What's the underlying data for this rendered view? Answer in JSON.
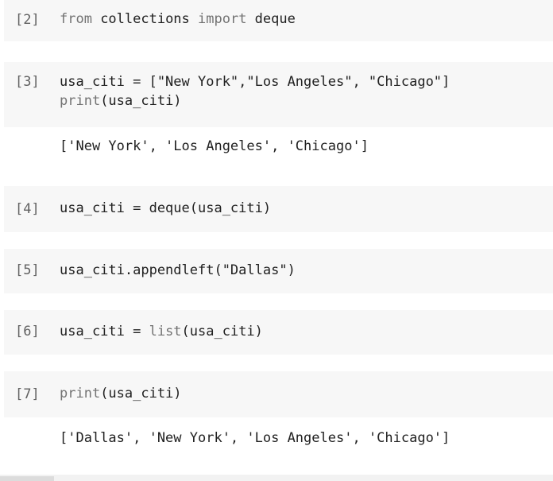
{
  "cells": [
    {
      "prompt": "[2]",
      "tokens": {
        "kw1": "from",
        "mod": " collections ",
        "kw2": "import",
        "name": " deque"
      }
    },
    {
      "prompt": "[3]",
      "line1": "usa_citi = [\"New York\",\"Los Angeles\", \"Chicago\"]",
      "line2_fn": "print",
      "line2_rest": "(usa_citi)",
      "output": "['New York', 'Los Angeles', 'Chicago']"
    },
    {
      "prompt": "[4]",
      "code": "usa_citi = deque(usa_citi)"
    },
    {
      "prompt": "[5]",
      "code": "usa_citi.appendleft(\"Dallas\")"
    },
    {
      "prompt": "[6]",
      "code_a": "usa_citi = ",
      "code_fn": "list",
      "code_b": "(usa_citi)"
    },
    {
      "prompt": "[7]",
      "code_fn": "print",
      "code_b": "(usa_citi)",
      "output": "['Dallas', 'New York', 'Los Angeles', 'Chicago']"
    }
  ],
  "colors": {
    "cell_bg": "#f7f7f7",
    "prompt": "#616161",
    "keyword": "#737373",
    "text": "#212121"
  }
}
